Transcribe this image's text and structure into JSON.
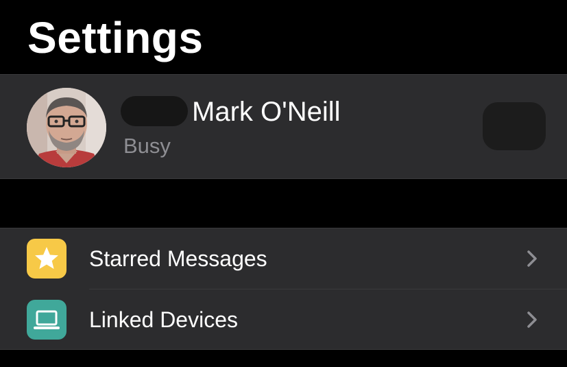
{
  "header": {
    "title": "Settings"
  },
  "profile": {
    "name": "Mark O'Neill",
    "status": "Busy",
    "avatar_icon": "profile-photo",
    "qr_icon": "qr-code-icon"
  },
  "menu": {
    "items": [
      {
        "label": "Starred Messages",
        "icon": "star-icon",
        "icon_bg": "#f7c947"
      },
      {
        "label": "Linked Devices",
        "icon": "laptop-icon",
        "icon_bg": "#40a89a"
      }
    ]
  },
  "colors": {
    "background": "#000000",
    "cell": "#2c2c2e",
    "separator": "#3a3a3c",
    "secondary_text": "#8e8e93",
    "chevron": "#8e8e93"
  }
}
